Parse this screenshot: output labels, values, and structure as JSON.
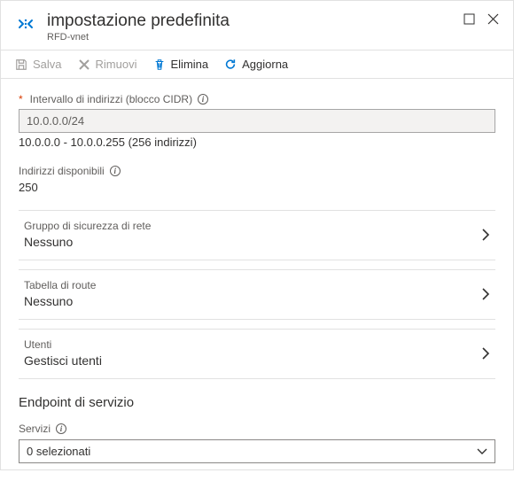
{
  "header": {
    "title": "impostazione predefinita",
    "subtitle": "RFD-vnet"
  },
  "toolbar": {
    "save": "Salva",
    "remove": "Rimuovi",
    "delete": "Elimina",
    "refresh": "Aggiorna"
  },
  "cidr": {
    "label": "Intervallo di indirizzi (blocco CIDR)",
    "value": "10.0.0.0/24",
    "helper": "10.0.0.0 - 10.0.0.255 (256 indirizzi)"
  },
  "available": {
    "label": "Indirizzi disponibili",
    "value": "250"
  },
  "cards": [
    {
      "label": "Gruppo di sicurezza di rete",
      "value": "Nessuno"
    },
    {
      "label": "Tabella di route",
      "value": "Nessuno"
    },
    {
      "label": "Utenti",
      "value": "Gestisci utenti"
    }
  ],
  "section": {
    "title": "Endpoint di servizio",
    "services_label": "Servizi",
    "services_value": "0 selezionati"
  }
}
